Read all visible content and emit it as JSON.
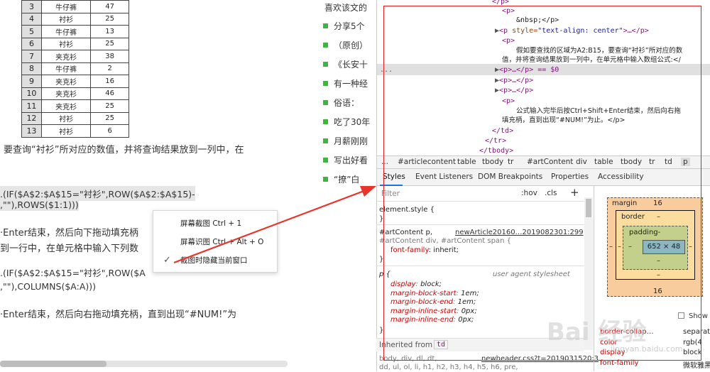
{
  "sheet": {
    "rows": [
      [
        "3",
        "牛仔裤",
        "47"
      ],
      [
        "4",
        "衬衫",
        "25"
      ],
      [
        "5",
        "牛仔裤",
        "13"
      ],
      [
        "6",
        "衬衫",
        "25"
      ],
      [
        "7",
        "夹克衫",
        "38"
      ],
      [
        "8",
        "牛仔裤",
        "2"
      ],
      [
        "9",
        "夹克衫",
        "16"
      ],
      [
        "10",
        "夹克衫",
        "46"
      ],
      [
        "11",
        "夹克衫",
        "25"
      ],
      [
        "12",
        "衬衫",
        "25"
      ],
      [
        "13",
        "衬衫",
        "6"
      ]
    ]
  },
  "article": {
    "p1": "要查询“衬衫”所对应的数值，并将查询结果放到一列中，在",
    "f1a": ".(IF($A$2:$A$15=\"衬衫\",ROW($A$2:$A$15)-",
    "f1b": ",\"\"),ROWS($1:1)))",
    "p2a": "·Enter结束，然后向下拖动填充柄",
    "p2b": "到一行中，在单元格中输入下列数",
    "f2a": ".(IF($A$2:$A$15=\"衬衫\",ROW($A",
    "f2b": ",\"\"),COLUMNS($A:A)))",
    "p3": "·Enter结束，然后向右拖动填充柄，直到出现“#NUM!”为"
  },
  "menu": {
    "item1": "屏幕截图 Ctrl + 1",
    "item2": "屏幕识图 Ctrl + Alt + O",
    "item3": "截图时隐藏当前窗口",
    "check": "✓"
  },
  "sidebar": {
    "title": "喜欢该文的",
    "items": [
      "分享5个",
      "（原创）",
      "《长安十",
      "有一种经",
      "俗语：",
      "吃了30年",
      "月薪刚刚",
      "写出好看",
      "“撩”白"
    ]
  },
  "elements": {
    "l1": "</p>",
    "l2": "<p>",
    "l3": "&nbsp;</p>",
    "l4a": "<p ",
    "l4b": "style=",
    "l4c": "\"text-align: center\"",
    "l4d": ">…</p>",
    "l5": "<p>",
    "l6": "假如要查找的区域为A2:B15，要查询“衬衫”所对应的数",
    "l7": "值，并将查询结果放到一列中，在单元格中输入数组公式:</",
    "l8": "<p>…</p> == $0",
    "l9": "<p>…</p>",
    "l10": "<p>…</p>",
    "l11": "<p>",
    "l12": "公式输入完毕后按Ctrl+Shift+Enter结束，然后向右拖",
    "l13": "填充柄，直到出现“#NUM!”为止。</p>",
    "l14": "</td>",
    "l15": "</tr>",
    "l16": "</tbody>",
    "dots": "..."
  },
  "breadcrumbs": [
    "...",
    "#articlecontent",
    "table",
    "tbody",
    "tr",
    "#artContent",
    "div",
    "table",
    "tbody",
    "tr",
    "td",
    "p"
  ],
  "tabs": [
    "Styles",
    "Event Listeners",
    "DOM Breakpoints",
    "Properties",
    "Accessibility"
  ],
  "filter": {
    "placeholder": "Filter",
    "hov": ":hov",
    "cls": ".cls",
    "plus": "+"
  },
  "styles": {
    "element_style": "element.style {",
    "close": "}",
    "rule1_sel": "#artContent p,",
    "rule1_src": "newArticle20160…2019082301:299",
    "rule1_sel2": "#artContent div, #artContent span {",
    "rule1_prop": "font-family",
    "rule1_val": "inherit;",
    "ua_sel": "p {",
    "ua_src": "user agent stylesheet",
    "ua_props": [
      [
        "display",
        "block;"
      ],
      [
        "margin-block-start",
        "1em;"
      ],
      [
        "margin-block-end",
        "1em;"
      ],
      [
        "margin-inline-start",
        "0px;"
      ],
      [
        "margin-inline-end",
        "0px;"
      ]
    ],
    "inherited": "Inherited from",
    "inherited_tag": "td",
    "last1": "body, div, dl, dt,",
    "last1_src": "newheader.css?t=2019031520:3",
    "last2": "dd, ul, ol, li, h1, h2, h3, h4, h5, h6, pre,"
  },
  "boxmodel": {
    "margin_label": "margin",
    "margin_top": "16",
    "margin_bottom": "16",
    "border_label": "border",
    "border_val": "–",
    "padding_label": "padding-",
    "padding_val": "–",
    "content": "652 × 48",
    "side": "–"
  },
  "computed": {
    "show_all": "Show a",
    "rows": [
      [
        "border-collap…",
        "separat"
      ],
      [
        "color",
        "rgb(4"
      ],
      [
        "display",
        "block"
      ],
      [
        "font-family",
        "微软雅黑"
      ]
    ]
  },
  "watermark": "Bai 经验",
  "watermark_sub": "jingyan.baidu.com"
}
